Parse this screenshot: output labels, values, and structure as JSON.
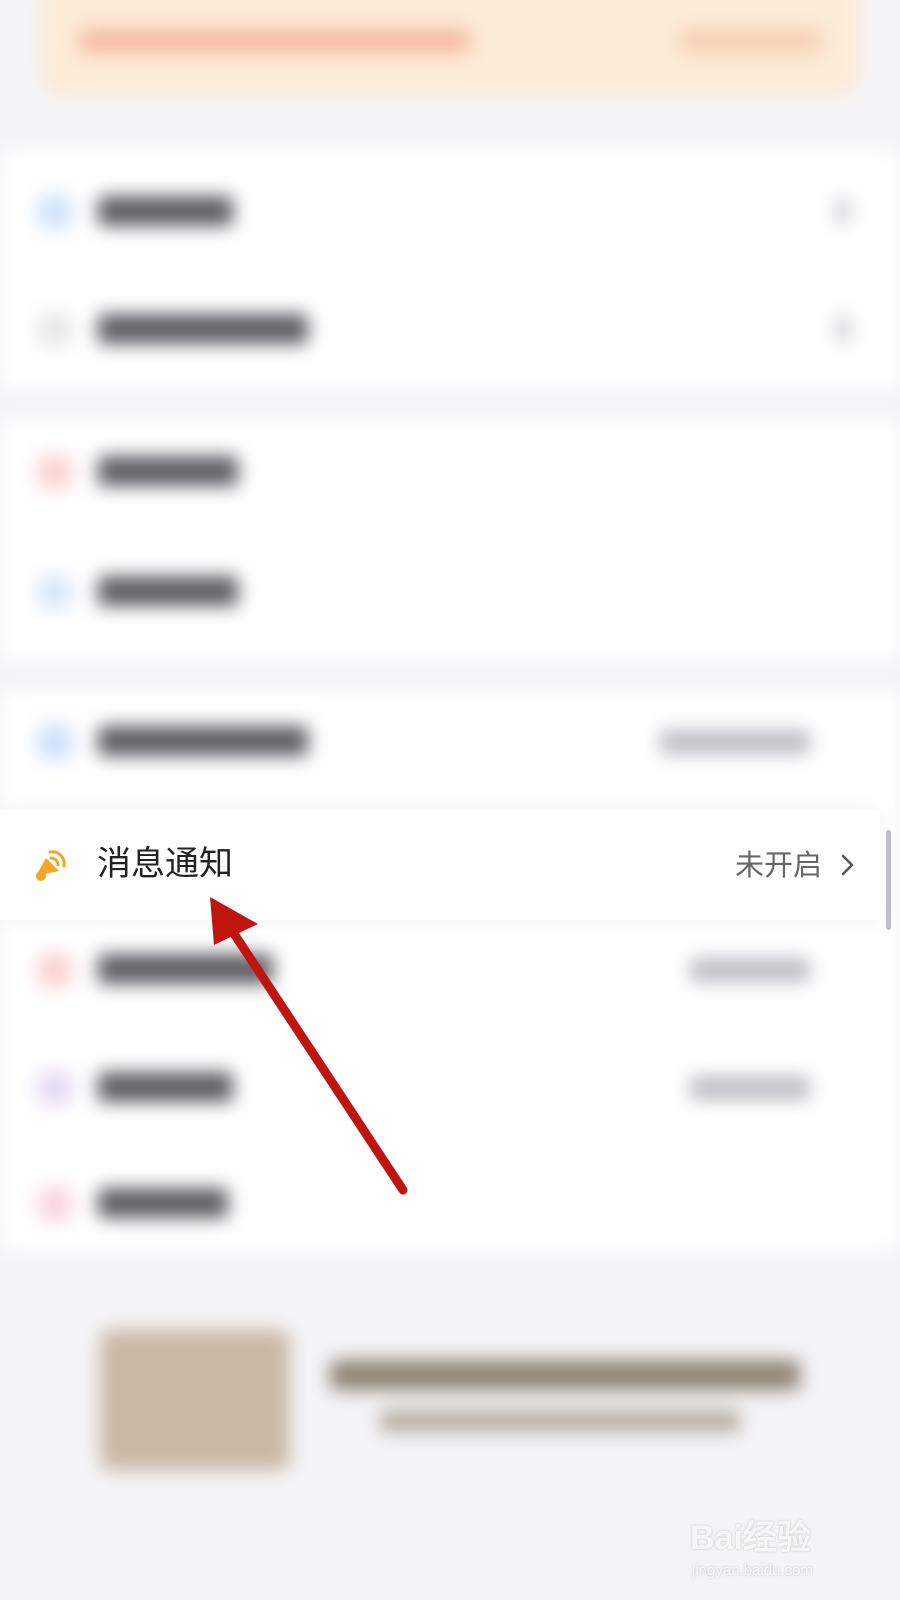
{
  "notification_row": {
    "title": "消息通知",
    "status": "未开启",
    "icon": "megaphone-icon",
    "icon_color": "#f5a623"
  },
  "annotation": {
    "arrow_color": "#c0150f"
  },
  "watermark": {
    "logo": "Bai经验",
    "url": "jingyan.baidu.com"
  }
}
